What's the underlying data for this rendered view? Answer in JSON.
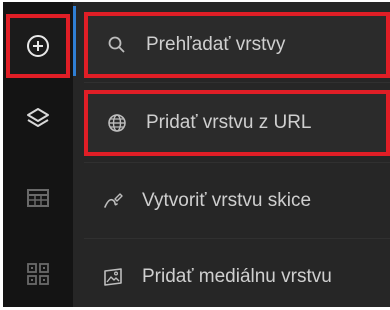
{
  "panel": {
    "items": [
      {
        "label": "Prehľadať vrstvy",
        "icon": "search-icon"
      },
      {
        "label": "Pridať vrstvu z URL",
        "icon": "globe-icon"
      },
      {
        "label": "Vytvoriť vrstvu skice",
        "icon": "sketch-icon"
      },
      {
        "label": "Pridať mediálnu vrstvu",
        "icon": "image-icon"
      }
    ]
  },
  "rail": {
    "items": [
      {
        "icon": "add-circle-icon",
        "active": true
      },
      {
        "icon": "layers-icon"
      },
      {
        "icon": "table-icon"
      },
      {
        "icon": "grid-icon"
      }
    ]
  },
  "colors": {
    "highlight": "#e01e26",
    "accent": "#2f7fd4",
    "rail_bg": "#141414",
    "panel_bg": "#262626",
    "text": "#cfcfcf"
  }
}
